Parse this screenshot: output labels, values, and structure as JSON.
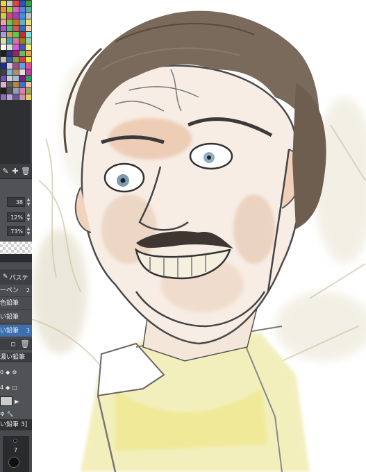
{
  "palette": {
    "swatches": [
      "#e8d44a",
      "#c8c8c8",
      "#e84040",
      "#3050c8",
      "#40a040",
      "#f09030",
      "#a0d040",
      "#e060c0",
      "#6080e0",
      "#50b0a0",
      "#d0d040",
      "#e04080",
      "#a040c0",
      "#4090e0",
      "#c0c0c0",
      "#f0a0a0",
      "#80c040",
      "#d07020",
      "#60b0d0",
      "#e8e070",
      "#b050d0",
      "#40c080",
      "#e05050",
      "#3070c0",
      "#f0d0a0",
      "#a0a0e0",
      "#d0a040",
      "#50d050",
      "#c03030",
      "#80e0e0",
      "#e0e0a0",
      "#40a0c0",
      "#e070a0",
      "#908020",
      "#a0d0a0",
      "#ffffff",
      "#e0e0e0",
      "#d060d0",
      "#5050b0",
      "#f0f080",
      "#202020",
      "#303090",
      "#a02070",
      "#60c060",
      "#e0a060",
      "#c0c0c0",
      "#3060a0",
      "#80a040",
      "#d04040",
      "#f0e040",
      "#1030a0",
      "#e0c0e0",
      "#a05080",
      "#60a0e0",
      "#e05090",
      "#404040",
      "#80b0e0",
      "#b09060",
      "#e0e0e0",
      "#c040a0",
      "#7050c0",
      "#d0d0d0",
      "#a0c0e0",
      "#802080",
      "#30a060",
      "#e0b0d0",
      "#606060",
      "#c08040",
      "#4070d0",
      "#f0c0a0",
      "#202020",
      "#505050",
      "#90a0c0",
      "#e080a0",
      "#a0a060",
      "#9070b0",
      "#c0a0e0",
      "#606090",
      "#d090b0",
      "#e0d060"
    ],
    "tools": {
      "a": "✎",
      "b": "✚",
      "c": "🗑"
    }
  },
  "props": {
    "values": [
      "38",
      "12%",
      "73%"
    ]
  },
  "brush": {
    "tab_label": "パステ",
    "items": [
      {
        "label": "一ペン",
        "num": "2"
      },
      {
        "label": "色鉛筆",
        "num": ""
      },
      {
        "label": "い鉛筆",
        "num": ""
      },
      {
        "label": "い鉛筆",
        "num": "3"
      }
    ],
    "selected": 3
  },
  "sub": {
    "title": "濃い鉛筆",
    "row1": "0",
    "row2": "4"
  },
  "bottom": {
    "title": "い鉛筆 3]",
    "size": "7"
  }
}
